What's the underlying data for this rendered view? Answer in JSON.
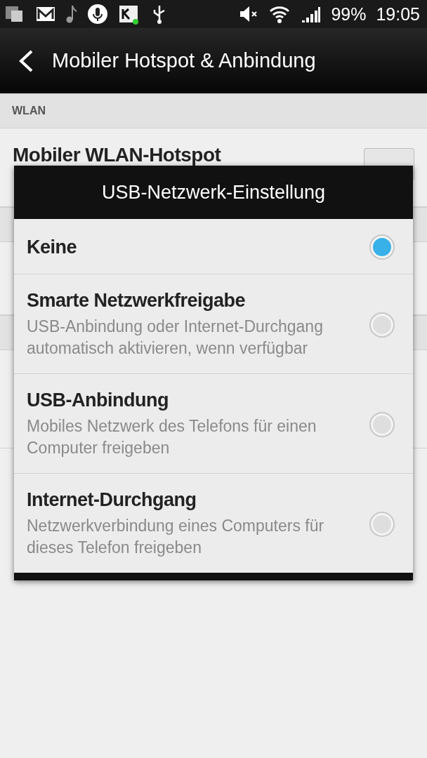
{
  "status_bar": {
    "battery": "99%",
    "time": "19:05"
  },
  "action_bar": {
    "title": "Mobiler Hotspot & Anbindung"
  },
  "background": {
    "section": "WLAN",
    "row_title": "Mobiler WLAN-Hotspot",
    "toggle_on": false
  },
  "dialog": {
    "title": "USB-Netzwerk-Einstellung",
    "options": [
      {
        "title": "Keine",
        "selected": true
      },
      {
        "title": "Smarte Netzwerkfreigabe",
        "description": "USB-Anbindung oder Internet-Durchgang automatisch aktivieren, wenn verfügbar",
        "selected": false
      },
      {
        "title": "USB-Anbindung",
        "description": "Mobiles Netzwerk des Telefons für einen Computer freigeben",
        "selected": false
      },
      {
        "title": "Internet-Durchgang",
        "description": "Netzwerkverbindung eines Computers für dieses Telefon freigeben",
        "selected": false
      }
    ]
  }
}
